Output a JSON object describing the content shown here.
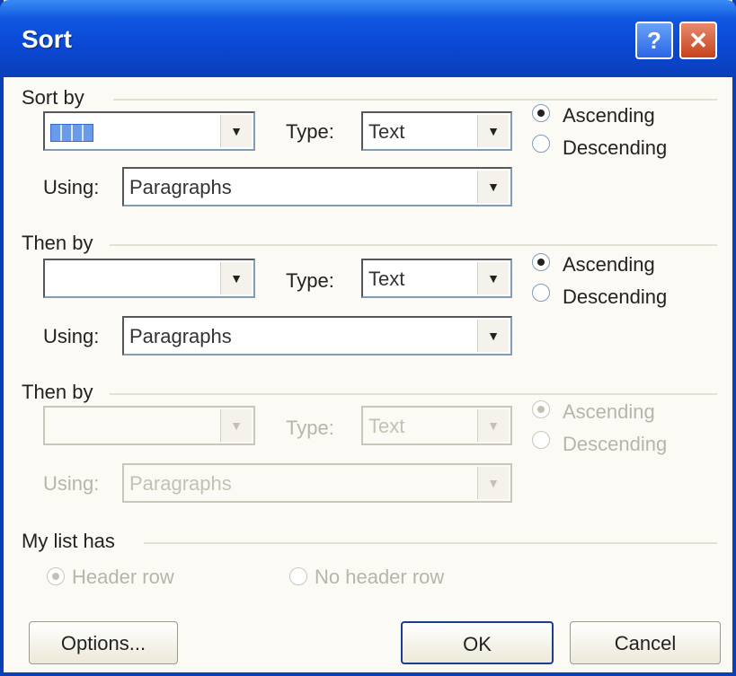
{
  "window": {
    "title": "Sort",
    "help": "?",
    "close": "✕"
  },
  "sort_by": {
    "heading": "Sort by",
    "column_value": "",
    "type_label": "Type:",
    "type_value": "Text",
    "using_label": "Using:",
    "using_value": "Paragraphs",
    "ascending": "Ascending",
    "descending": "Descending"
  },
  "then_by_1": {
    "heading": "Then by",
    "column_value": "",
    "type_label": "Type:",
    "type_value": "Text",
    "using_label": "Using:",
    "using_value": "Paragraphs",
    "ascending": "Ascending",
    "descending": "Descending"
  },
  "then_by_2": {
    "heading": "Then by",
    "column_value": "",
    "type_label": "Type:",
    "type_value": "Text",
    "using_label": "Using:",
    "using_value": "Paragraphs",
    "ascending": "Ascending",
    "descending": "Descending"
  },
  "list_has": {
    "heading": "My list has",
    "header_row": "Header row",
    "no_header_row": "No header row"
  },
  "buttons": {
    "options": "Options...",
    "ok": "OK",
    "cancel": "Cancel"
  },
  "colors": {
    "title_bar": "#0a48d4",
    "frame": "#0a3fb8",
    "disabled_text": "#b7b5ab"
  }
}
